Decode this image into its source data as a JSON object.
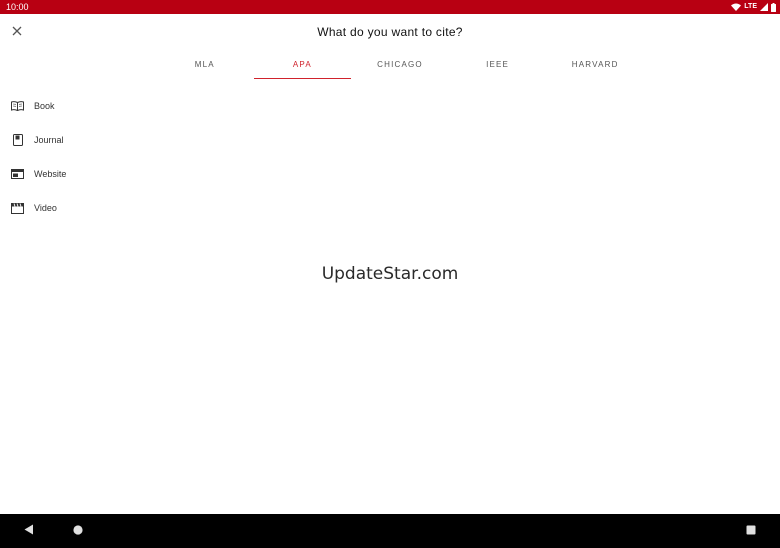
{
  "status_bar": {
    "time": "10:00",
    "network_label": "LTE",
    "background_color": "#b80012",
    "icons": [
      "wifi-icon",
      "signal-icon",
      "battery-icon"
    ]
  },
  "header": {
    "title": "What do you want to cite?",
    "close_icon": "close-icon"
  },
  "tabs": [
    {
      "label": "MLA",
      "active": false
    },
    {
      "label": "APA",
      "active": true
    },
    {
      "label": "CHICAGO",
      "active": false
    },
    {
      "label": "IEEE",
      "active": false
    },
    {
      "label": "HARVARD",
      "active": false
    }
  ],
  "accent_color": "#d0222c",
  "sources": [
    {
      "label": "Book",
      "icon": "book-icon"
    },
    {
      "label": "Journal",
      "icon": "journal-icon"
    },
    {
      "label": "Website",
      "icon": "website-icon"
    },
    {
      "label": "Video",
      "icon": "video-icon"
    }
  ],
  "watermark": "UpdateStar.com",
  "nav_bar": {
    "buttons": [
      "back-icon",
      "home-icon",
      "recents-icon"
    ]
  }
}
